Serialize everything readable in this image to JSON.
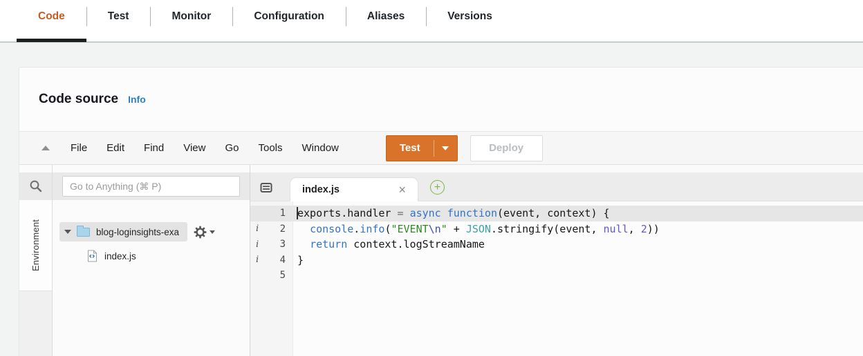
{
  "colors": {
    "accent": "#C45C23",
    "underline": "#1B1F1F",
    "info_link": "#2D7FC2",
    "test_button": "#D9732A",
    "plus_green": "#7FB347"
  },
  "nav_tabs": [
    {
      "label": "Code",
      "active": true
    },
    {
      "label": "Test",
      "active": false
    },
    {
      "label": "Monitor",
      "active": false
    },
    {
      "label": "Configuration",
      "active": false
    },
    {
      "label": "Aliases",
      "active": false
    },
    {
      "label": "Versions",
      "active": false
    }
  ],
  "panel": {
    "title": "Code source",
    "info_label": "Info"
  },
  "menubar": {
    "menus": [
      "File",
      "Edit",
      "Find",
      "View",
      "Go",
      "Tools",
      "Window"
    ],
    "test_label": "Test",
    "deploy_label": "Deploy"
  },
  "sidebar": {
    "search_placeholder": "Go to Anything (⌘ P)",
    "environment_label": "Environment",
    "folder_label": "blog-loginsights-exa",
    "file_label": "index.js"
  },
  "editor": {
    "tab_label": "index.js",
    "line_count": 5,
    "annotated_lines": [
      2,
      3,
      4
    ],
    "token_colors": {
      "plain": "#161616",
      "kw": "#3273C5",
      "str": "#2E8B22",
      "esc": "#3F4E9C",
      "cls": "#3AA3A8",
      "num": "#6257CE",
      "op": "#6A6A6A"
    },
    "code_lines": [
      [
        {
          "t": "exports.handler ",
          "c": "plain"
        },
        {
          "t": "= ",
          "c": "op"
        },
        {
          "t": "async ",
          "c": "kw"
        },
        {
          "t": "function",
          "c": "kw"
        },
        {
          "t": "(event, context) {",
          "c": "plain"
        }
      ],
      [
        {
          "t": "  ",
          "c": "plain"
        },
        {
          "t": "console",
          "c": "kw"
        },
        {
          "t": ".",
          "c": "plain"
        },
        {
          "t": "info",
          "c": "kw"
        },
        {
          "t": "(",
          "c": "plain"
        },
        {
          "t": "\"EVENT",
          "c": "str"
        },
        {
          "t": "\\n",
          "c": "esc"
        },
        {
          "t": "\"",
          "c": "str"
        },
        {
          "t": " + ",
          "c": "plain"
        },
        {
          "t": "JSON",
          "c": "cls"
        },
        {
          "t": ".stringify(event, ",
          "c": "plain"
        },
        {
          "t": "null",
          "c": "num"
        },
        {
          "t": ", ",
          "c": "plain"
        },
        {
          "t": "2",
          "c": "num"
        },
        {
          "t": "))",
          "c": "plain"
        }
      ],
      [
        {
          "t": "  ",
          "c": "plain"
        },
        {
          "t": "return",
          "c": "kw"
        },
        {
          "t": " context.logStreamName",
          "c": "plain"
        }
      ],
      [
        {
          "t": "}",
          "c": "plain"
        }
      ],
      []
    ]
  },
  "icons": {
    "close_tab": "×",
    "add_tab": "+",
    "annotation_info": "i"
  }
}
